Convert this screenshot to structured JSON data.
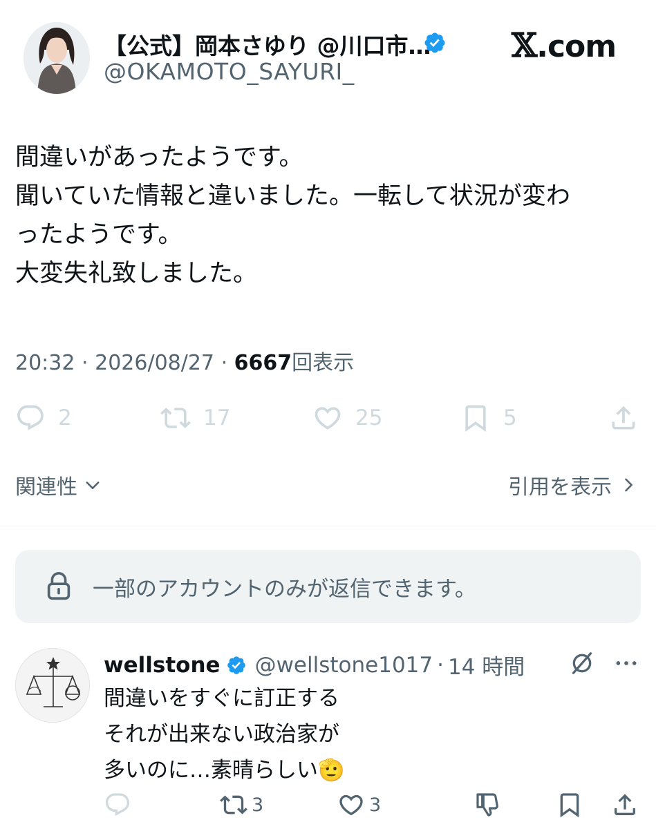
{
  "tweet": {
    "display_name": "【公式】岡本さゆり @川口市…",
    "handle": "@OKAMOTO_SAYURI_",
    "brand": {
      "symbol": "𝕏",
      "domain": ".com"
    },
    "text_lines": [
      "間違いがあったようです。",
      "聞いていた情報と違いました。一転して状況が変わ",
      "ったようです。",
      "大変失礼致しました。"
    ],
    "time": "20:32",
    "date": "2026/08/27",
    "views_count": "6667",
    "views_label": "回表示",
    "separator": "·",
    "counts": {
      "replies": "2",
      "retweets": "17",
      "likes": "25",
      "bookmarks": "5"
    }
  },
  "sort": {
    "label": "関連性",
    "icon": "chevron-down-icon"
  },
  "quotes_link": {
    "label": "引用を表示",
    "icon": "chevron-right-icon"
  },
  "reply_restriction": {
    "text": "一部のアカウントのみが返信できます。",
    "icon": "lock-icon"
  },
  "reply": {
    "name": "wellstone",
    "handle": "@wellstone1017",
    "time": "14 時間",
    "separator": "·",
    "text_lines": [
      "間違いをすぐに訂正する",
      "それが出来ない政治家が",
      "多いのに…素晴らしい🫡"
    ],
    "counts": {
      "retweets": "3",
      "likes": "3"
    }
  },
  "colors": {
    "verified": "#1d9bf0",
    "muted": "#536471",
    "faded_icon": "#cfd9de",
    "panel": "#eff3f4"
  }
}
